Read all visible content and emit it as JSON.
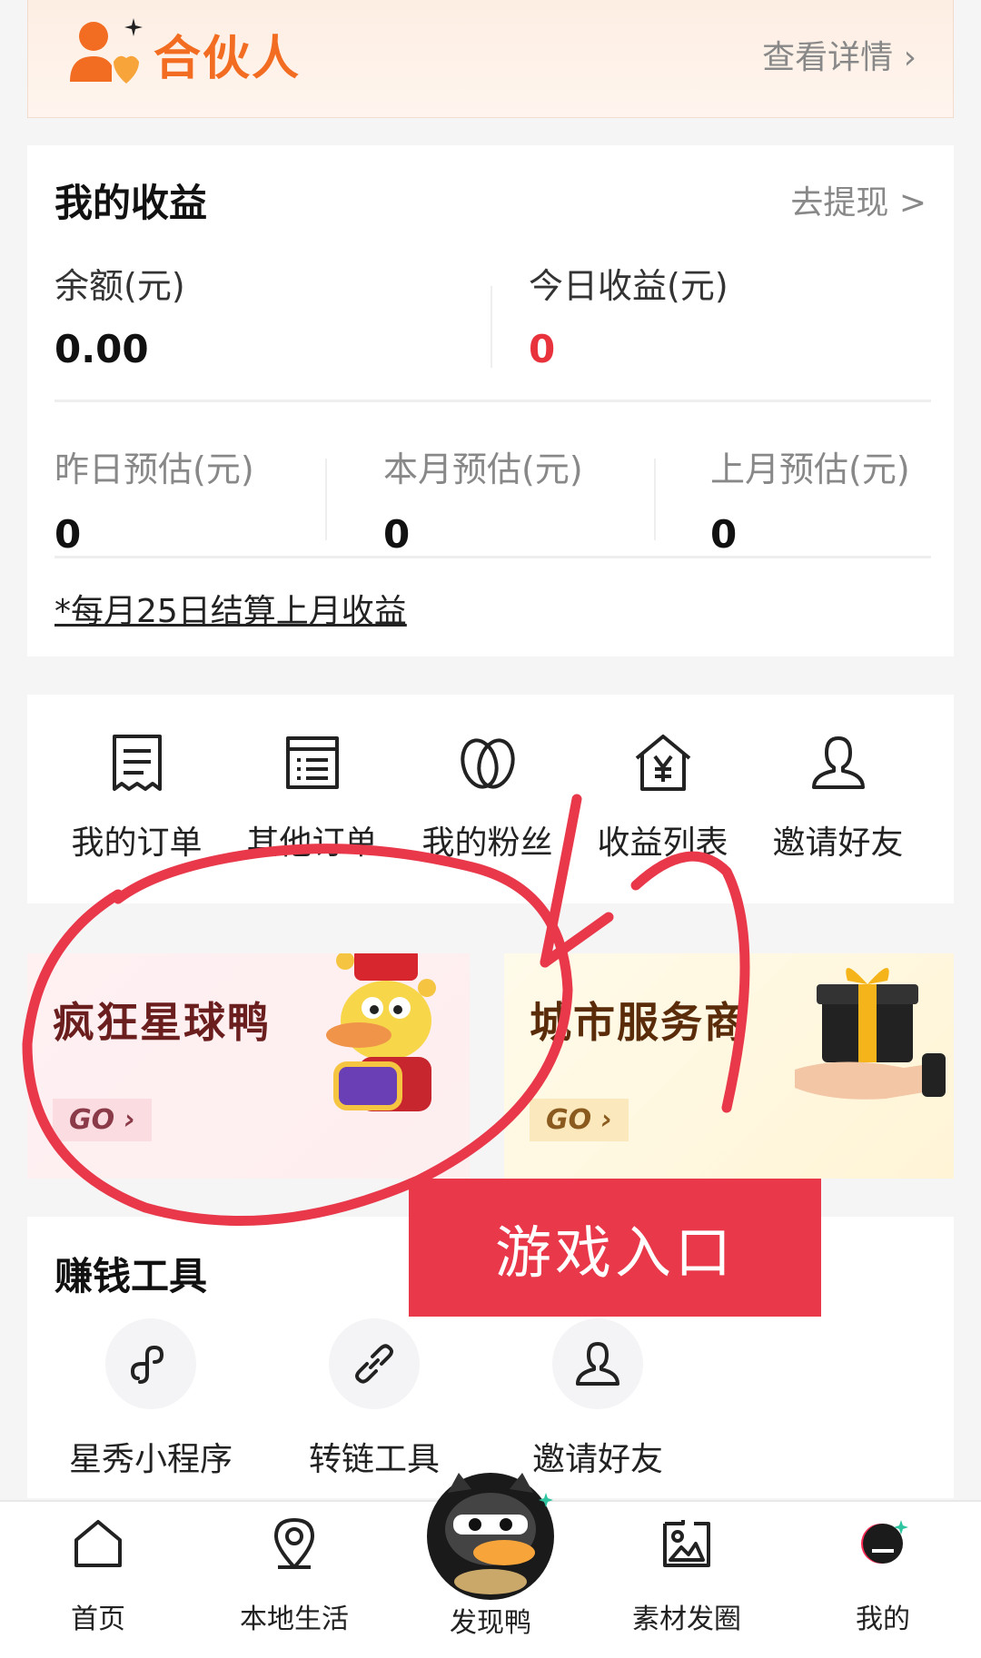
{
  "partner": {
    "title": "合伙人",
    "link": "查看详情 ›"
  },
  "earnings": {
    "title": "我的收益",
    "withdraw": "去提现 >",
    "balance_label": "余额(元)",
    "balance_value": "0.00",
    "today_label": "今日收益(元)",
    "today_value": "0",
    "yesterday_label": "昨日预估(元)",
    "yesterday_value": "0",
    "month_label": "本月预估(元)",
    "month_value": "0",
    "last_month_label": "上月预估(元)",
    "last_month_value": "0",
    "settle_note": "*每月25日结算上月收益"
  },
  "shortcuts": [
    {
      "label": "我的订单",
      "icon": "receipt-icon"
    },
    {
      "label": "其他订单",
      "icon": "list-icon"
    },
    {
      "label": "我的粉丝",
      "icon": "fans-icon"
    },
    {
      "label": "收益列表",
      "icon": "yen-house-icon"
    },
    {
      "label": "邀请好友",
      "icon": "person-icon"
    }
  ],
  "promos": [
    {
      "title": "疯狂星球鸭",
      "go": "GO ›"
    },
    {
      "title": "城市服务商",
      "go": "GO ›"
    }
  ],
  "tools": {
    "title": "赚钱工具",
    "items": [
      {
        "label": "星秀小程序",
        "icon": "miniprogram-icon"
      },
      {
        "label": "转链工具",
        "icon": "link-icon"
      },
      {
        "label": "邀请好友",
        "icon": "person-icon"
      }
    ]
  },
  "annotation": {
    "label": "游戏入口",
    "color": "#e8384a"
  },
  "tabbar": [
    {
      "label": "首页",
      "icon": "home-icon"
    },
    {
      "label": "本地生活",
      "icon": "location-icon"
    },
    {
      "label": "发现鸭",
      "icon": "duck-icon"
    },
    {
      "label": "素材发圈",
      "icon": "material-icon"
    },
    {
      "label": "我的",
      "icon": "profile-icon"
    }
  ],
  "colors": {
    "accent": "#f26d22",
    "red": "#e8323c"
  }
}
